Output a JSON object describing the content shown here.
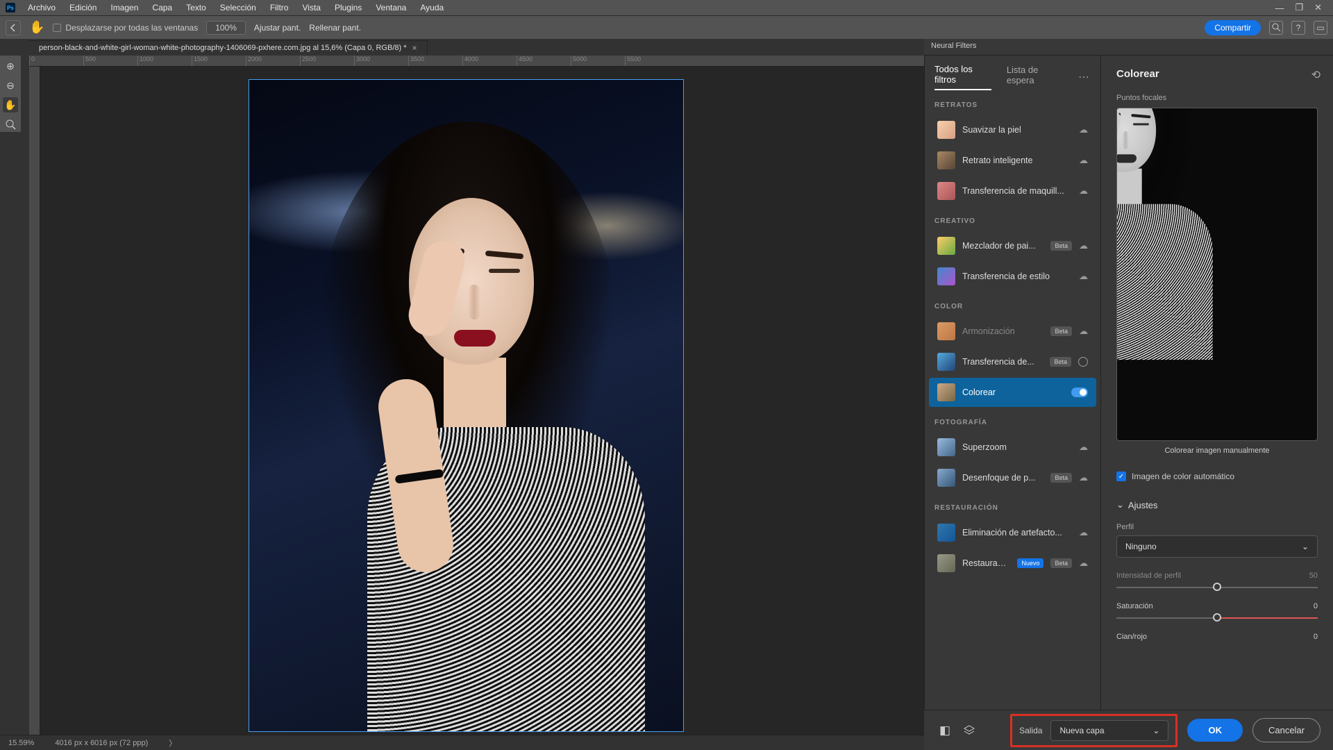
{
  "menubar": [
    "Archivo",
    "Edición",
    "Imagen",
    "Capa",
    "Texto",
    "Selección",
    "Filtro",
    "Vista",
    "Plugins",
    "Ventana",
    "Ayuda"
  ],
  "optbar": {
    "scroll_all": "Desplazarse por todas las ventanas",
    "zoom100": "100%",
    "fit": "Ajustar pant.",
    "fill": "Rellenar pant.",
    "share": "Compartir"
  },
  "doc": {
    "title": "person-black-and-white-girl-woman-white-photography-1406069-pxhere.com.jpg al 15,6% (Capa 0, RGB/8) *"
  },
  "ruler_h": [
    "0",
    "500",
    "1000",
    "1500",
    "2000",
    "2500",
    "3000",
    "3500",
    "4000",
    "4500",
    "5000",
    "5500"
  ],
  "status": {
    "zoom": "15.59%",
    "dims": "4016 px x 6016 px (72 ppp)"
  },
  "nf": {
    "header": "Neural Filters",
    "tabs": {
      "all": "Todos los filtros",
      "wait": "Lista de espera"
    },
    "cats": {
      "retratos": "RETRATOS",
      "creativo": "CREATIVO",
      "color": "COLOR",
      "foto": "FOTOGRAFÍA",
      "rest": "RESTAURACIÓN"
    },
    "items": {
      "skin": "Suavizar la piel",
      "smart": "Retrato inteligente",
      "makeup": "Transferencia de maquill...",
      "landscape": "Mezclador de pai...",
      "style": "Transferencia de estilo",
      "harmon": "Armonización",
      "colortransfer": "Transferencia de...",
      "colorize": "Colorear",
      "superzoom": "Superzoom",
      "depth": "Desenfoque de p...",
      "jpeg": "Eliminación de artefacto...",
      "restore": "Restauraci..."
    },
    "badges": {
      "beta": "Beta",
      "new": "Nuevo"
    }
  },
  "right": {
    "title": "Colorear",
    "focal": "Puntos focales",
    "manual": "Colorear imagen manualmente",
    "auto": "Imagen de color automático",
    "adjust": "Ajustes",
    "profile": "Perfil",
    "profile_val": "Ninguno",
    "intensity": "Intensidad de perfil",
    "intensity_val": "50",
    "sat": "Saturación",
    "sat_val": "0",
    "cyan": "Cian/rojo",
    "cyan_val": "0"
  },
  "bottom": {
    "salida": "Salida",
    "salida_val": "Nueva capa",
    "ok": "OK",
    "cancel": "Cancelar"
  }
}
